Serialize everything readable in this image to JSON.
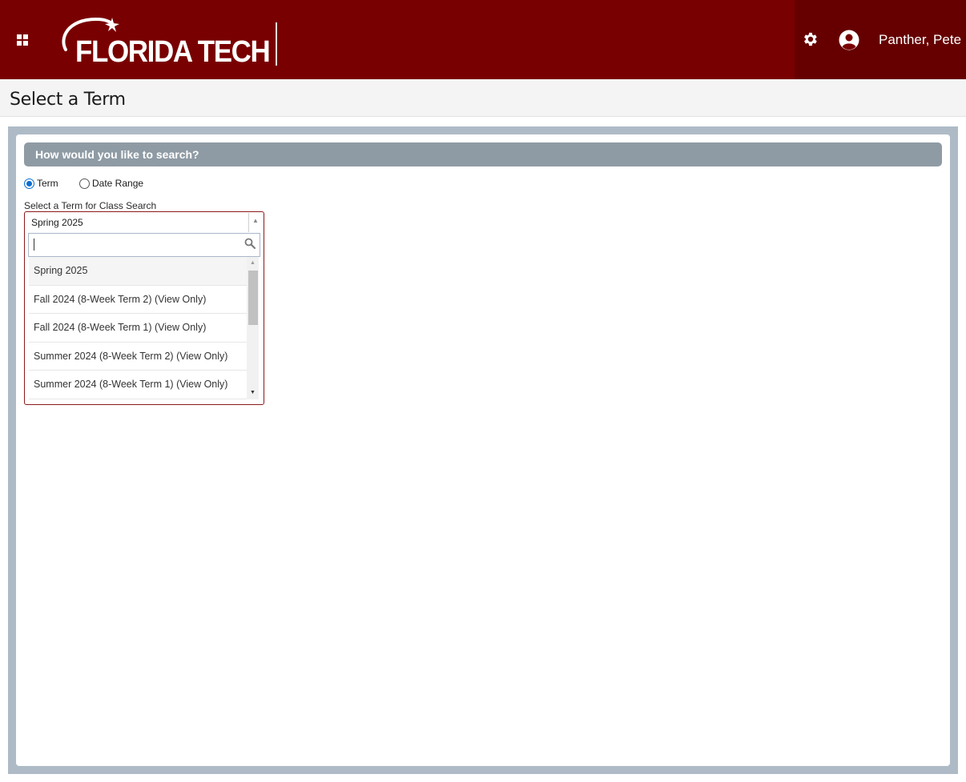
{
  "header": {
    "brand": "FLORIDA TECH",
    "user_name": "Panther, Pete",
    "icons": {
      "menu": "grid-icon",
      "settings": "gear-icon",
      "user": "user-avatar-icon"
    },
    "colors": {
      "primary": "#790000",
      "accent_dark": "#660000"
    }
  },
  "page": {
    "title": "Select a Term"
  },
  "search": {
    "section_title": "How would you like to search?",
    "mode_options": [
      {
        "label": "Term",
        "selected": true
      },
      {
        "label": "Date Range",
        "selected": false
      }
    ],
    "term_field_label": "Select a Term for Class Search",
    "selected_term": "Spring 2025",
    "search_query": "",
    "term_options": [
      "Spring 2025",
      "Fall 2024 (8-Week Term 2) (View Only)",
      "Fall 2024 (8-Week Term 1) (View Only)",
      "Summer 2024 (8-Week Term 2) (View Only)",
      "Summer 2024 (8-Week Term 1) (View Only)"
    ]
  }
}
